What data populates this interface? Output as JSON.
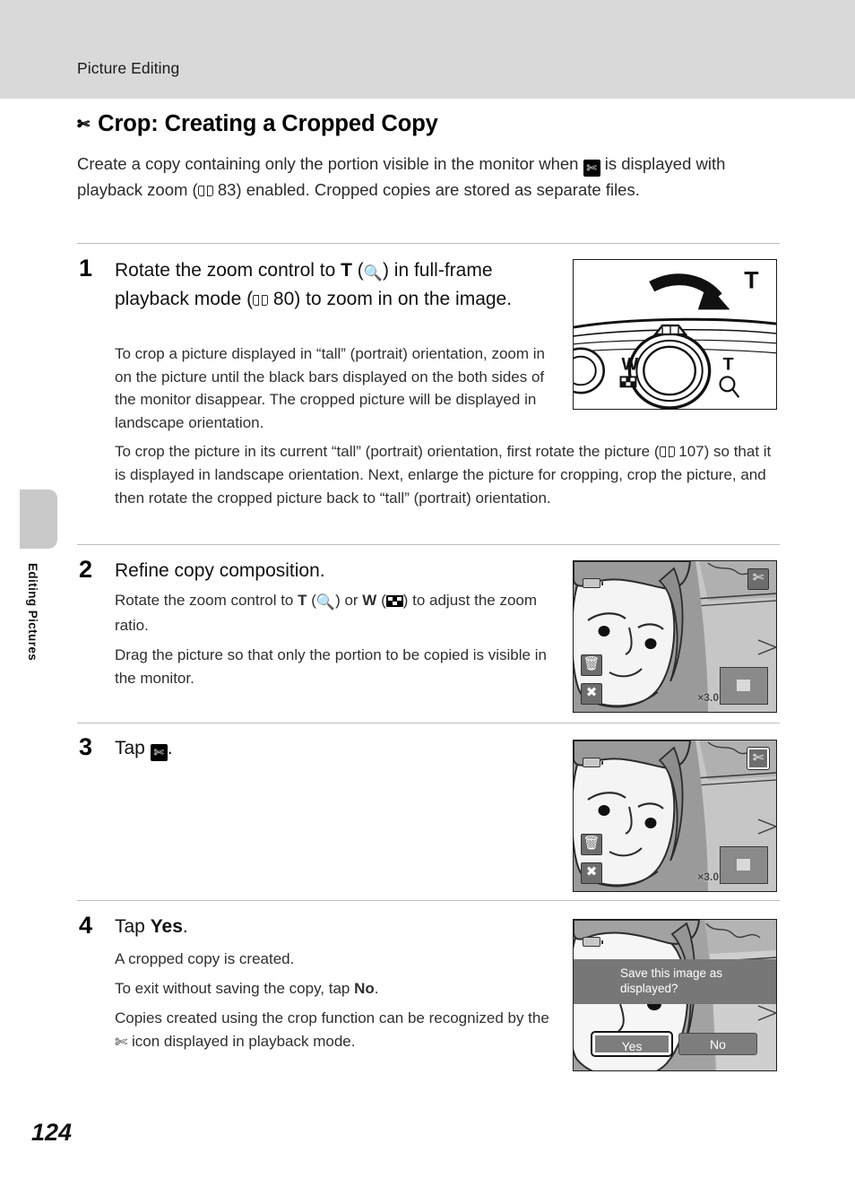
{
  "header": {
    "chapter_title": "Picture Editing"
  },
  "side_tab": {
    "label": "Editing Pictures"
  },
  "footer": {
    "page_number": "124"
  },
  "section": {
    "icon": "scissors-icon",
    "title": "Crop: Creating a Cropped Copy",
    "intro_part1": "Create a copy containing only the portion visible in the monitor when ",
    "intro_part2": " is displayed with playback zoom (",
    "intro_ref_page": "83",
    "intro_part3": ") enabled. Cropped copies are stored as separate files."
  },
  "steps": [
    {
      "number": "1",
      "heading_part1": "Rotate the zoom control to ",
      "heading_t": "T",
      "heading_part2": " (",
      "heading_part3": ") in full-frame playback mode (",
      "heading_ref_page": "80",
      "heading_part4": ") to zoom in on the image.",
      "body1": "To crop a picture displayed in “tall” (portrait) orientation, zoom in on the picture until the black bars displayed on the both sides of the monitor disappear. The cropped picture will be displayed in landscape orientation.",
      "body2_part1": "To crop the picture in its current “tall” (portrait) orientation, first rotate the picture (",
      "body2_ref_page": "107",
      "body2_part2": ") so that it is displayed in landscape orientation. Next, enlarge the picture for cropping, crop the picture, and then rotate the cropped picture back to “tall” (portrait) orientation.",
      "figure": {
        "name": "zoom-control-illustration",
        "label_t_arrow": "T",
        "label_w": "W",
        "label_t": "T"
      }
    },
    {
      "number": "2",
      "heading": "Refine copy composition.",
      "body1_part1": "Rotate the zoom control to ",
      "body1_t": "T",
      "body1_part2": " (",
      "body1_part3": ") or ",
      "body1_w": "W",
      "body1_part4": " (",
      "body1_part5": ") to adjust the zoom ratio.",
      "body2": "Drag the picture so that only the portion to be copied is visible in the monitor.",
      "figure": {
        "name": "monitor-refine-composition",
        "zoom_ratio": "×3.0",
        "crop_button": "scissors-icon",
        "delete_button": "trash-icon",
        "cancel_button": "x-icon",
        "battery": "battery-icon",
        "nav_indicator": "crop-area-indicator"
      }
    },
    {
      "number": "3",
      "heading_part1": "Tap ",
      "heading_part2": ".",
      "figure": {
        "name": "monitor-tap-crop",
        "zoom_ratio": "×3.0",
        "crop_button": "scissors-icon",
        "crop_button_state": "selected",
        "delete_button": "trash-icon",
        "cancel_button": "x-icon",
        "battery": "battery-icon",
        "nav_indicator": "crop-area-indicator"
      }
    },
    {
      "number": "4",
      "heading_part1": "Tap ",
      "heading_yes": "Yes",
      "heading_part2": ".",
      "body1": "A cropped copy is created.",
      "body2_part1": "To exit without saving the copy, tap ",
      "body2_no": "No",
      "body2_part2": ".",
      "body3_part1": "Copies created using the crop function can be recognized by the ",
      "body3_part2": " icon displayed in playback mode.",
      "figure": {
        "name": "monitor-save-dialog",
        "dialog_message": "Save this image as displayed?",
        "button_yes": "Yes",
        "button_no": "No",
        "button_yes_state": "selected",
        "battery": "battery-icon"
      }
    }
  ],
  "colors": {
    "header_band": "#d9d9d9",
    "rule": "#bdbdbd",
    "monitor_bg": "#b4b4b4",
    "dialog_bar": "#777777",
    "button_fill": "#7d7d7d"
  }
}
